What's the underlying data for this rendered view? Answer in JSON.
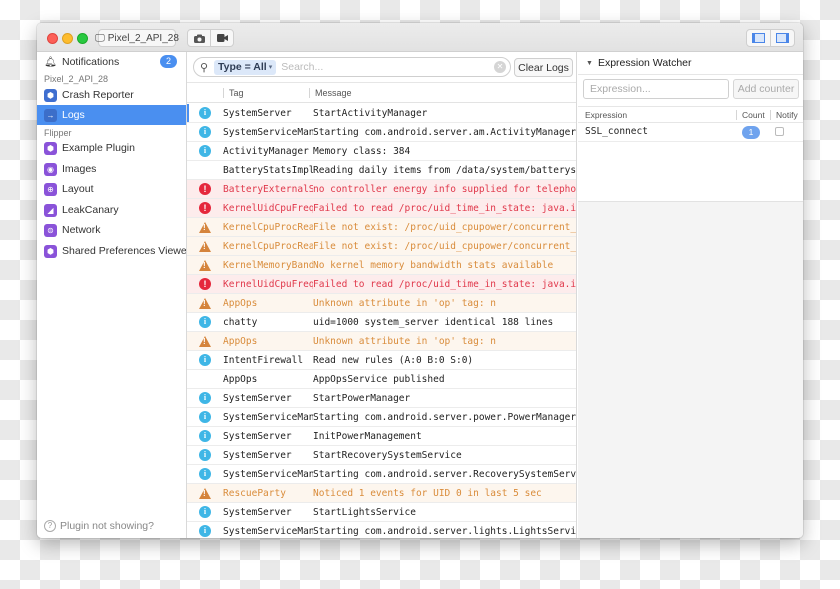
{
  "titlebar": {
    "device_label": "Pixel_2_API_28",
    "device_icon": "monitor-icon",
    "screenshot_icon": "camera-icon",
    "record_icon": "video-camera-icon",
    "layout_toggle_left_icon": "left-sidebar-toggle-icon",
    "layout_toggle_right_icon": "right-sidebar-toggle-icon"
  },
  "sidebar": {
    "notifications": {
      "label": "Notifications",
      "badge": "2",
      "icon": "bell-icon"
    },
    "sections": [
      {
        "header": "Pixel_2_API_28",
        "items": [
          {
            "label": "Crash Reporter",
            "icon": "box-icon",
            "active": false
          },
          {
            "label": "Logs",
            "icon": "arrow-right-icon",
            "active": true
          }
        ]
      },
      {
        "header": "Flipper",
        "items": [
          {
            "label": "Example Plugin",
            "icon": "box-icon",
            "active": false
          },
          {
            "label": "Images",
            "icon": "image-icon",
            "active": false
          },
          {
            "label": "Layout",
            "icon": "target-icon",
            "active": false
          },
          {
            "label": "LeakCanary",
            "icon": "bird-icon",
            "active": false
          },
          {
            "label": "Network",
            "icon": "globe-icon",
            "active": false
          },
          {
            "label": "Shared Preferences Viewer",
            "icon": "box-icon",
            "active": false
          }
        ]
      }
    ],
    "help_label": "Plugin not showing?"
  },
  "logs": {
    "filter_token": "Type = All",
    "search_placeholder": "Search...",
    "search_value": "",
    "clear_button": "Clear Logs",
    "columns": [
      "Tag",
      "Message"
    ],
    "rows": [
      {
        "level": "info",
        "tag": "SystemServer",
        "message": "StartActivityManager"
      },
      {
        "level": "info",
        "tag": "SystemServiceManager",
        "message": "Starting com.android.server.am.ActivityManagerService$Lifecycle"
      },
      {
        "level": "info",
        "tag": "ActivityManager",
        "message": "Memory class: 384"
      },
      {
        "level": "verbose",
        "tag": "BatteryStatsImpl",
        "message": "Reading daily items from /data/system/batterystats-daily.xml"
      },
      {
        "level": "error",
        "tag": "BatteryExternalStatsWorker",
        "message": "no controller energy info supplied for telephony"
      },
      {
        "level": "error",
        "tag": "KernelUidCpuFreqTimeReader",
        "message": "Failed to read /proc/uid_time_in_state: java.io"
      },
      {
        "level": "warn",
        "tag": "KernelCpuProcReader",
        "message": "File not exist: /proc/uid_cpupower/concurrent_active_time"
      },
      {
        "level": "warn",
        "tag": "KernelCpuProcReader",
        "message": "File not exist: /proc/uid_cpupower/concurrent_policy_time"
      },
      {
        "level": "warn",
        "tag": "KernelMemoryBandwidthStats",
        "message": "No kernel memory bandwidth stats available"
      },
      {
        "level": "error",
        "tag": "KernelUidCpuFreqTimeReader",
        "message": "Failed to read /proc/uid_time_in_state: java.io"
      },
      {
        "level": "warn",
        "tag": "AppOps",
        "message": "Unknown attribute in 'op' tag: n"
      },
      {
        "level": "info",
        "tag": "chatty",
        "message": "uid=1000 system_server identical 188 lines"
      },
      {
        "level": "warn",
        "tag": "AppOps",
        "message": "Unknown attribute in 'op' tag: n"
      },
      {
        "level": "info",
        "tag": "IntentFirewall",
        "message": "Read new rules (A:0 B:0 S:0)"
      },
      {
        "level": "verbose",
        "tag": "AppOps",
        "message": "AppOpsService published"
      },
      {
        "level": "info",
        "tag": "SystemServer",
        "message": "StartPowerManager"
      },
      {
        "level": "info",
        "tag": "SystemServiceManager",
        "message": "Starting com.android.server.power.PowerManagerService"
      },
      {
        "level": "info",
        "tag": "SystemServer",
        "message": "InitPowerManagement"
      },
      {
        "level": "info",
        "tag": "SystemServer",
        "message": "StartRecoverySystemService"
      },
      {
        "level": "info",
        "tag": "SystemServiceManager",
        "message": "Starting com.android.server.RecoverySystemService"
      },
      {
        "level": "warn",
        "tag": "RescueParty",
        "message": "Noticed 1 events for UID 0 in last 5 sec"
      },
      {
        "level": "info",
        "tag": "SystemServer",
        "message": "StartLightsService"
      },
      {
        "level": "info",
        "tag": "SystemServiceManager",
        "message": "Starting com.android.server.lights.LightsService"
      }
    ]
  },
  "expression_watcher": {
    "title": "Expression Watcher",
    "input_placeholder": "Expression...",
    "input_value": "",
    "add_button": "Add counter",
    "columns": [
      "Expression",
      "Count",
      "Notify"
    ],
    "rows": [
      {
        "expression": "SSL_connect",
        "count": "1",
        "notify": false
      }
    ]
  },
  "colors": {
    "accent": "#4a8ff0",
    "error": "#e5283c",
    "warning": "#d5843c",
    "info": "#3fb6e6"
  }
}
